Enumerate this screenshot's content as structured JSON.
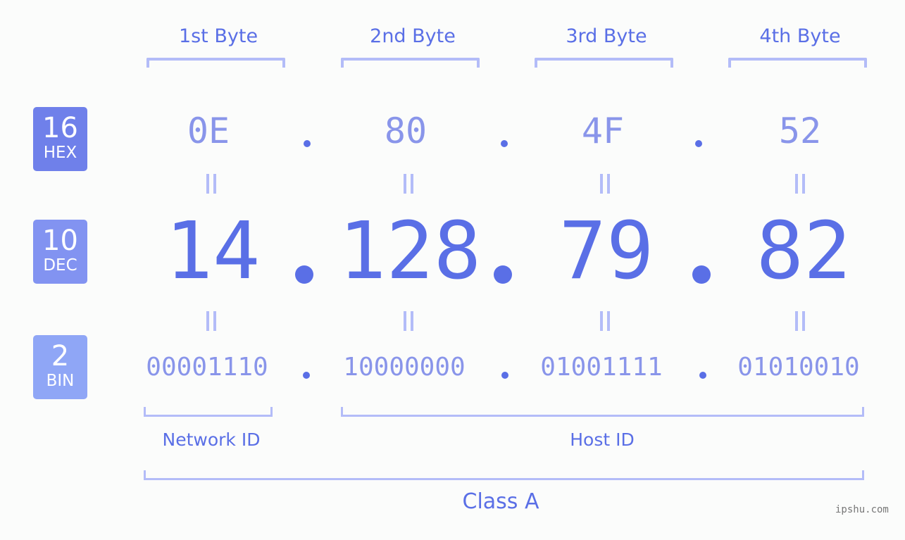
{
  "byte_headers": [
    "1st Byte",
    "2nd Byte",
    "3rd Byte",
    "4th Byte"
  ],
  "badges": {
    "hex": {
      "number": "16",
      "label": "HEX"
    },
    "dec": {
      "number": "10",
      "label": "DEC"
    },
    "bin": {
      "number": "2",
      "label": "BIN"
    }
  },
  "ip": {
    "hex": [
      "0E",
      "80",
      "4F",
      "52"
    ],
    "dec": [
      "14",
      "128",
      "79",
      "82"
    ],
    "bin": [
      "00001110",
      "10000000",
      "01001111",
      "01010010"
    ]
  },
  "segments": {
    "network_label": "Network ID",
    "host_label": "Host ID",
    "class_label": "Class A"
  },
  "watermark": "ipshu.com",
  "colors": {
    "accent": "#5a6fe6",
    "muted_value": "#8995ea",
    "bracket": "#b3bcf8",
    "badge_hex": "#6f80ea",
    "badge_dec": "#8293f1",
    "badge_bin": "#8fa6f6",
    "background": "#fbfcfb"
  }
}
